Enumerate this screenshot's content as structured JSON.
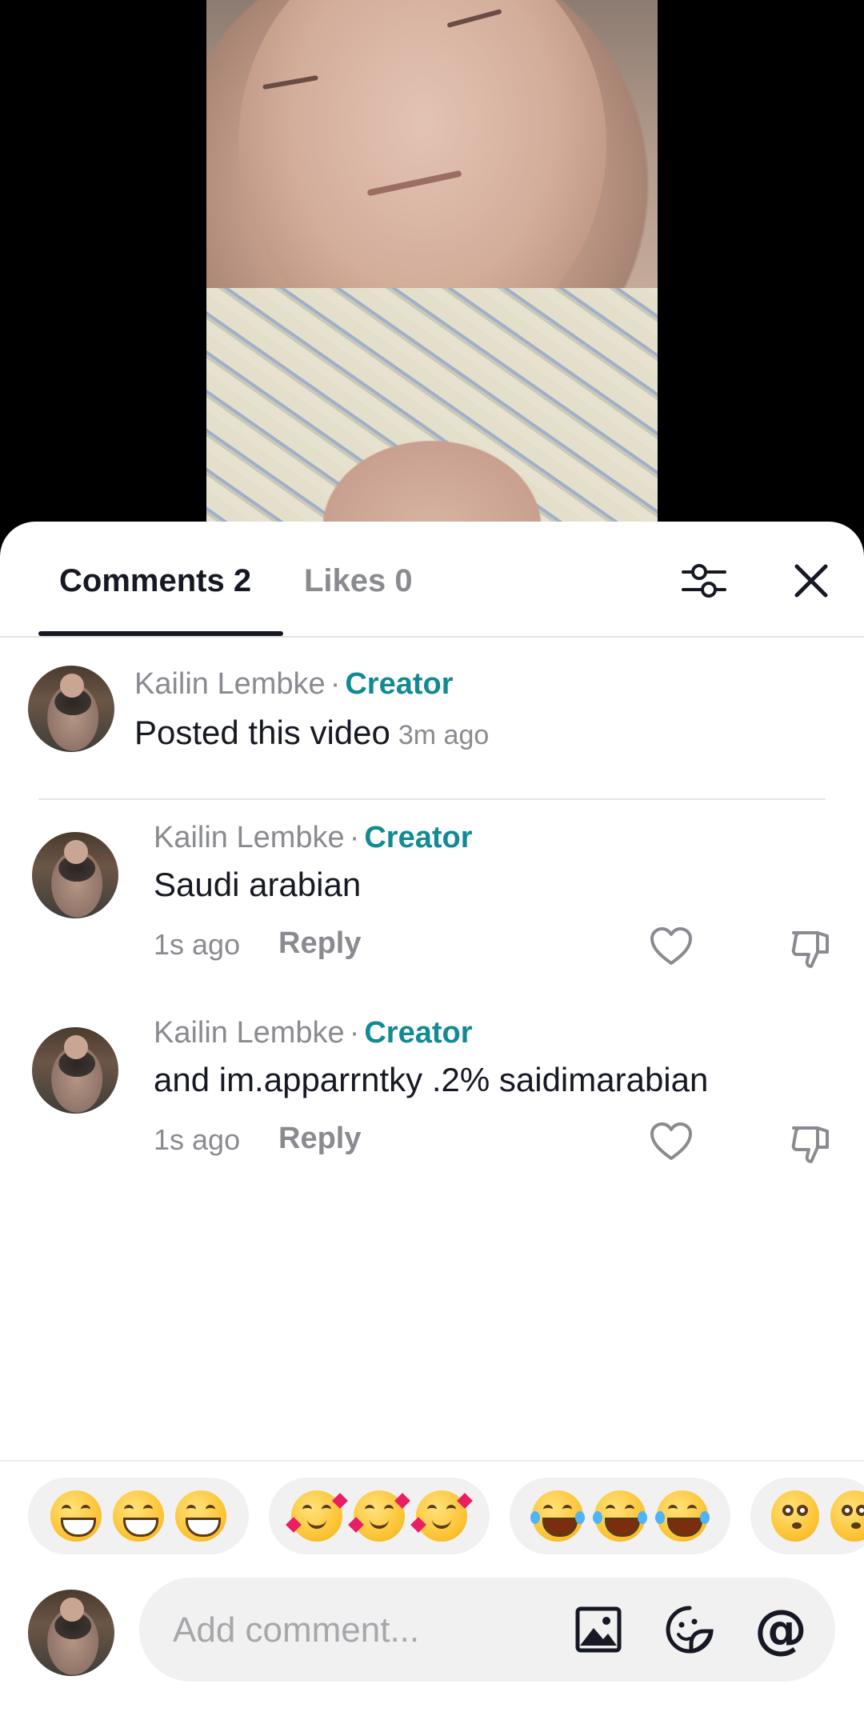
{
  "tabs": {
    "comments_label": "Comments 2",
    "likes_label": "Likes 0"
  },
  "creator_post": {
    "author": "Kailin Lembke",
    "separator": "·",
    "badge": "Creator",
    "text": "Posted this video",
    "time": "3m ago"
  },
  "comments": [
    {
      "author": "Kailin Lembke",
      "separator": "·",
      "badge": "Creator",
      "text": "Saudi arabian",
      "time": "1s ago",
      "reply_label": "Reply"
    },
    {
      "author": "Kailin Lembke",
      "separator": "·",
      "badge": "Creator",
      "text": "and im.apparrntky .2% saidimarabian",
      "time": "1s ago",
      "reply_label": "Reply"
    }
  ],
  "emoji_suggestions": [
    "beaming-face",
    "smiling-face-with-hearts",
    "tears-of-joy",
    "flushed-face"
  ],
  "composer": {
    "placeholder": "Add comment..."
  },
  "colors": {
    "creator_badge": "#128a94",
    "text_primary": "#161823",
    "text_secondary": "#8a8b91"
  },
  "icons": [
    "filter-icon",
    "close-icon",
    "heart-icon",
    "dislike-icon",
    "image-icon",
    "sticker-icon",
    "mention-icon"
  ]
}
